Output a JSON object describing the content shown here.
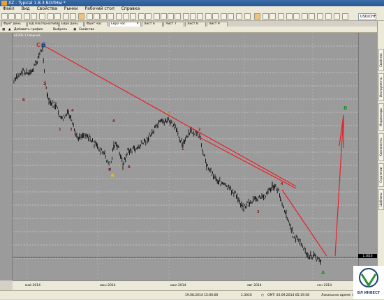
{
  "window": {
    "title": "XZ - Typical 1.8.3 ВОЛНЫ *"
  },
  "menu": [
    "Файл",
    "Вид",
    "Свойства",
    "Рынки",
    "Рабочий стол",
    "Справка"
  ],
  "toolbar": {
    "symbol": "USD/CHF"
  },
  "tabs": [
    "Фунт день",
    "ВД Альтернатива",
    "Евро день",
    "Фунт час",
    "Евро час",
    "Лист 6",
    "Лист 7",
    "Лист 8",
    "Лист 9"
  ],
  "subbar": {
    "add_chart": "Добавить график",
    "select": "Выбрать",
    "properties": "Свойства",
    "legend": "БЕЗОБ 1 Сводный"
  },
  "side_tabs": [
    "Свойства",
    "Инструменты",
    "Индикаторы",
    "Компоненты",
    "Стратегии",
    "Шаблоны"
  ],
  "axis": {
    "x_labels": [
      "май 2014",
      "июн 2014",
      "июл 2014",
      "авг 2014",
      "сен 2014"
    ],
    "last_price": "1.3016"
  },
  "wave_labels": {
    "c": "C",
    "five": "5",
    "b_top": "B",
    "a_bottom": "A",
    "mid_a": "A",
    "mid_b": "B",
    "mid_5": "5",
    "mid_4": "4",
    "mid_3": "3",
    "left_b": "B",
    "left_4": "4",
    "left_2": "2",
    "left_1": "1",
    "right_1": "1",
    "right_2": "2",
    "right_4": "4",
    "right_3": "3"
  },
  "status": {
    "datetime": "19.08.2014 15:00:00",
    "value": "1.3016",
    "gmt": "GMT: 03.09.2014 05:19:58",
    "local": "Локальное время: 03"
  },
  "brand": {
    "name": "ВЛ ИНВЕСТ"
  },
  "colors": {
    "chart_bg": "#9b9b9b",
    "trendline": "#e8202a",
    "grid": "#ffffff",
    "wave_label": "#8b1a1a"
  }
}
